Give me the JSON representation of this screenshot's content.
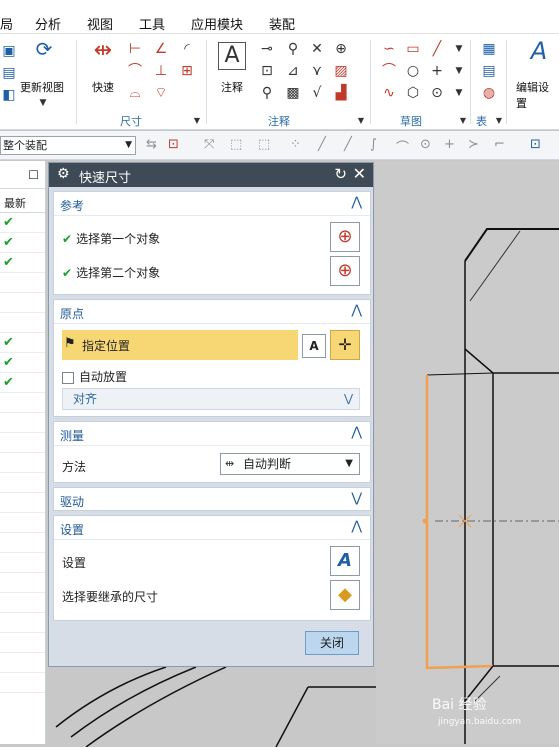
{
  "menu": {
    "items": [
      "局",
      "分析",
      "视图",
      "工具",
      "应用模块",
      "装配"
    ]
  },
  "ribbon": {
    "update_view": "更新视图",
    "quick": "快速",
    "annotation_big": "注释",
    "edit_settings": "编辑设置",
    "groups": [
      "尺寸",
      "注释",
      "草图",
      "表"
    ]
  },
  "toolbar2": {
    "assembly_combo": "整个装配"
  },
  "left_panel": {
    "header": "最新",
    "checked_rows": [
      4,
      5,
      6,
      10,
      11,
      12
    ]
  },
  "dialog": {
    "title": "快速尺寸",
    "ref": {
      "label": "参考",
      "first": "选择第一个对象",
      "second": "选择第二个对象"
    },
    "origin": {
      "label": "原点",
      "specify": "指定位置",
      "auto_place": "自动放置",
      "align": "对齐"
    },
    "measure": {
      "label": "测量",
      "method_label": "方法",
      "method_value": "自动判断"
    },
    "drive": {
      "label": "驱动"
    },
    "settings": {
      "label": "设置",
      "settings_row": "设置",
      "inherit_row": "选择要继承的尺寸"
    },
    "close": "关闭"
  },
  "watermark": {
    "brand": "Bai 经验",
    "url": "jingyan.baidu.com"
  }
}
